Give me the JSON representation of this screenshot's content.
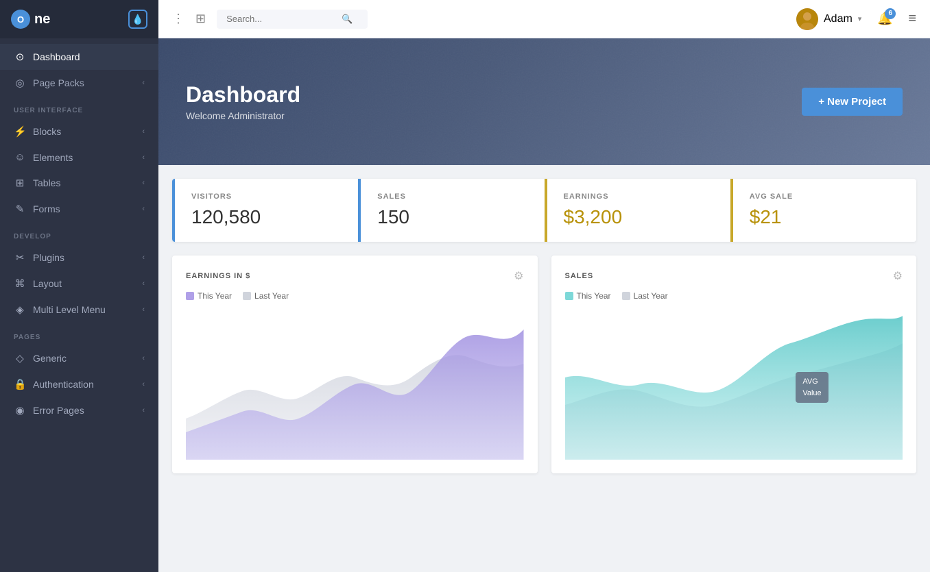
{
  "app": {
    "name": "ne",
    "logo_letter": "O"
  },
  "sidebar": {
    "main_items": [
      {
        "id": "dashboard",
        "label": "Dashboard",
        "icon": "⊙",
        "active": true,
        "arrow": false
      },
      {
        "id": "page-packs",
        "label": "Page Packs",
        "icon": "◎",
        "active": false,
        "arrow": true
      }
    ],
    "sections": [
      {
        "label": "USER INTERFACE",
        "items": [
          {
            "id": "blocks",
            "label": "Blocks",
            "icon": "⚡",
            "arrow": true
          },
          {
            "id": "elements",
            "label": "Elements",
            "icon": "☺",
            "arrow": true
          },
          {
            "id": "tables",
            "label": "Tables",
            "icon": "⊞",
            "arrow": true
          },
          {
            "id": "forms",
            "label": "Forms",
            "icon": "✎",
            "arrow": true
          }
        ]
      },
      {
        "label": "DEVELOP",
        "items": [
          {
            "id": "plugins",
            "label": "Plugins",
            "icon": "✂",
            "arrow": true
          },
          {
            "id": "layout",
            "label": "Layout",
            "icon": "⌘",
            "arrow": true
          },
          {
            "id": "multi-level-menu",
            "label": "Multi Level Menu",
            "icon": "◈",
            "arrow": true
          }
        ]
      },
      {
        "label": "PAGES",
        "items": [
          {
            "id": "generic",
            "label": "Generic",
            "icon": "◇",
            "arrow": true
          },
          {
            "id": "authentication",
            "label": "Authentication",
            "icon": "🔒",
            "arrow": true
          },
          {
            "id": "error-pages",
            "label": "Error Pages",
            "icon": "◉",
            "arrow": true
          }
        ]
      }
    ]
  },
  "topbar": {
    "search_placeholder": "Search...",
    "user_name": "Adam",
    "notif_count": "6"
  },
  "hero": {
    "title": "Dashboard",
    "subtitle": "Welcome Administrator",
    "new_project_label": "+ New Project"
  },
  "stats": [
    {
      "id": "visitors",
      "label": "VISITORS",
      "value": "120,580"
    },
    {
      "id": "sales",
      "label": "SALES",
      "value": "150"
    },
    {
      "id": "earnings",
      "label": "EARNINGS",
      "value": "$3,200"
    },
    {
      "id": "avg-sale",
      "label": "AVG SALE",
      "value": "$21"
    }
  ],
  "charts": [
    {
      "id": "earnings-chart",
      "title": "EARNINGS IN $",
      "legend": [
        {
          "label": "This Year",
          "color_class": "purple"
        },
        {
          "label": "Last Year",
          "color_class": "gray"
        }
      ]
    },
    {
      "id": "sales-chart",
      "title": "SALES",
      "legend": [
        {
          "label": "This Year",
          "color_class": "teal"
        },
        {
          "label": "Last Year",
          "color_class": "light-gray"
        }
      ],
      "tooltip_lines": [
        "AVG",
        "Value"
      ]
    }
  ]
}
